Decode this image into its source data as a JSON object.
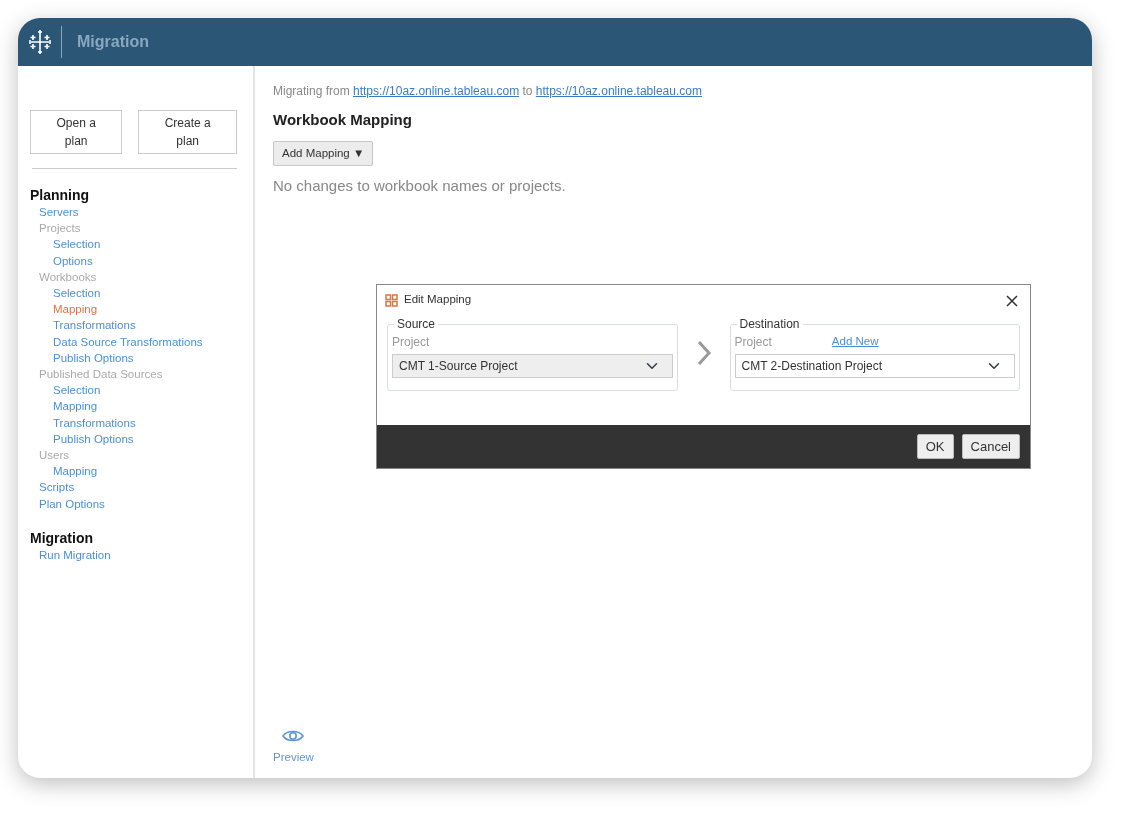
{
  "window": {
    "title": "Migration"
  },
  "sidebar": {
    "buttons": [
      "Open a plan",
      "Create a plan"
    ],
    "sections": [
      {
        "title": "Planning",
        "items": [
          {
            "label": "Servers",
            "kind": "link",
            "selected": false
          },
          {
            "label": "Projects",
            "kind": "group",
            "children": [
              {
                "label": "Selection",
                "kind": "link",
                "selected": false
              },
              {
                "label": "Options",
                "kind": "link",
                "selected": false
              }
            ]
          },
          {
            "label": "Workbooks",
            "kind": "group",
            "children": [
              {
                "label": "Selection",
                "kind": "link",
                "selected": false
              },
              {
                "label": "Mapping",
                "kind": "link",
                "selected": true
              },
              {
                "label": "Transformations",
                "kind": "link",
                "selected": false
              },
              {
                "label": "Data Source Transformations",
                "kind": "link",
                "selected": false
              },
              {
                "label": "Publish Options",
                "kind": "link",
                "selected": false
              }
            ]
          },
          {
            "label": "Published Data Sources",
            "kind": "group",
            "children": [
              {
                "label": "Selection",
                "kind": "link",
                "selected": false
              },
              {
                "label": "Mapping",
                "kind": "link",
                "selected": false
              },
              {
                "label": "Transformations",
                "kind": "link",
                "selected": false
              },
              {
                "label": "Publish Options",
                "kind": "link",
                "selected": false
              }
            ]
          },
          {
            "label": "Users",
            "kind": "group",
            "children": [
              {
                "label": "Mapping",
                "kind": "link",
                "selected": false
              }
            ]
          },
          {
            "label": "Scripts",
            "kind": "link",
            "selected": false
          },
          {
            "label": "Plan Options",
            "kind": "link",
            "selected": false
          }
        ]
      },
      {
        "title": "Migration",
        "items": [
          {
            "label": "Run Migration",
            "kind": "link",
            "selected": false
          }
        ]
      }
    ]
  },
  "main": {
    "migrating_prefix": "Migrating from",
    "source_url": "https://10az.online.tableau.com",
    "connector": "to",
    "destination_url": "https://10az.online.tableau.com",
    "title": "Workbook Mapping",
    "add_button": "Add Mapping",
    "add_caret": "▼",
    "empty_message": "No changes to workbook names or projects.",
    "preview": "Preview"
  },
  "dialog": {
    "title": "Edit Mapping",
    "source": {
      "legend": "Source",
      "label": "Project",
      "value": "CMT 1-Source Project",
      "disabled": true
    },
    "destination": {
      "legend": "Destination",
      "label": "Project",
      "link": "Add New",
      "value": "CMT 2-Destination Project",
      "disabled": false
    },
    "buttons": [
      "OK",
      "Cancel"
    ]
  }
}
